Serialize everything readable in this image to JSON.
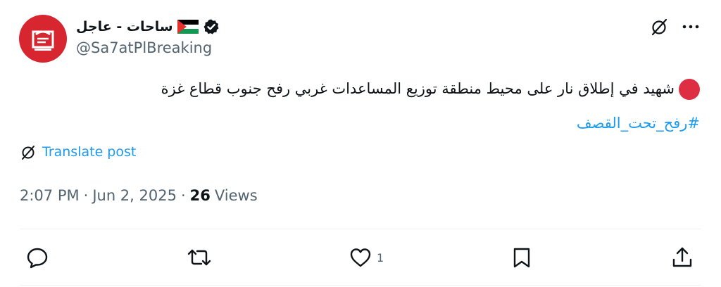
{
  "author": {
    "display_name": "ساحات - عاجل",
    "flag_emoji": "🇵🇸",
    "verified": true,
    "handle": "@Sa7atPlBreaking",
    "avatar_color": "#d7262f"
  },
  "post": {
    "status_emoji": "🔴",
    "text": "شهيد في إطلاق نار على محيط منطقة توزيع المساعدات غربي رفح جنوب قطاع غزة",
    "hashtag": "#رفح_تحت_القصف",
    "translate_label": "Translate post"
  },
  "meta": {
    "time": "2:07 PM",
    "separator": "·",
    "date": "Jun 2, 2025",
    "views_count": "26",
    "views_label": "Views"
  },
  "actions": {
    "reply_count": "",
    "repost_count": "",
    "like_count": "1",
    "bookmark_count": ""
  },
  "colors": {
    "link": "#1d9bf0",
    "secondary_text": "#536471",
    "primary_text": "#0f1419",
    "divider": "#eff3f4",
    "red_dot": "#dd2e44"
  },
  "icons": [
    "avatar-logo",
    "verified-badge-icon",
    "palestine-flag-icon",
    "grok-icon",
    "more-icon",
    "translate-icon",
    "reply-icon",
    "repost-icon",
    "like-icon",
    "bookmark-icon",
    "share-icon"
  ]
}
